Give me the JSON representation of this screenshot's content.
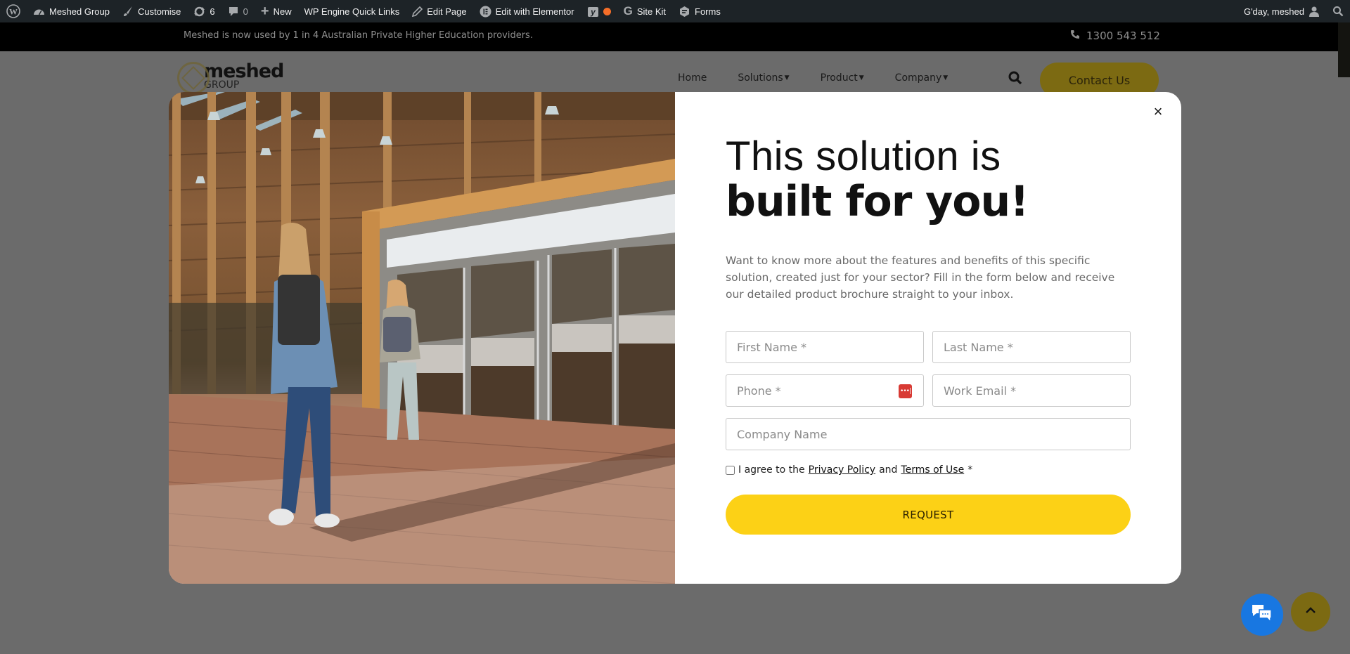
{
  "adminbar": {
    "site_name": "Meshed Group",
    "customise": "Customise",
    "updates_count": "6",
    "comments_count": "0",
    "new_label": "New",
    "wp_engine": "WP Engine Quick Links",
    "edit_page": "Edit Page",
    "edit_elementor": "Edit with Elementor",
    "site_kit": "Site Kit",
    "forms": "Forms",
    "greeting": "G'day, meshed"
  },
  "topbar": {
    "message": "Meshed is now used by 1 in 4 Australian Private Higher Education providers.",
    "phone": "1300 543 512"
  },
  "header": {
    "logo_word": "meshed",
    "logo_sub": "GROUP",
    "nav": [
      {
        "label": "Home",
        "has_dropdown": false
      },
      {
        "label": "Solutions",
        "has_dropdown": true
      },
      {
        "label": "Product",
        "has_dropdown": true
      },
      {
        "label": "Company",
        "has_dropdown": true
      }
    ],
    "contact_label": "Contact Us"
  },
  "modal": {
    "close_glyph": "×",
    "headline_light": "This solution is",
    "headline_bold": "built for you!",
    "intro": "Want to know more about the features and benefits of this specific solution, created just for your sector? Fill in the form below and receive our detailed product brochure straight to your inbox.",
    "fields": {
      "first_name": {
        "placeholder": "First Name *",
        "value": ""
      },
      "last_name": {
        "placeholder": "Last Name *",
        "value": ""
      },
      "phone": {
        "placeholder": "Phone *",
        "value": ""
      },
      "work_email": {
        "placeholder": "Work Email *",
        "value": ""
      },
      "company": {
        "placeholder": "Company Name",
        "value": ""
      }
    },
    "agree_prefix": "I agree to the",
    "privacy_link": "Privacy Policy",
    "agree_and": "and",
    "terms_link": "Terms of Use",
    "agree_required": "*",
    "agree_checked": false,
    "request_label": "REQUEST"
  },
  "colors": {
    "accent_yellow": "#fcd116",
    "overlay": "#6b6b6b",
    "chat_blue": "#1877e1",
    "adminbar_bg": "#1d2327"
  }
}
